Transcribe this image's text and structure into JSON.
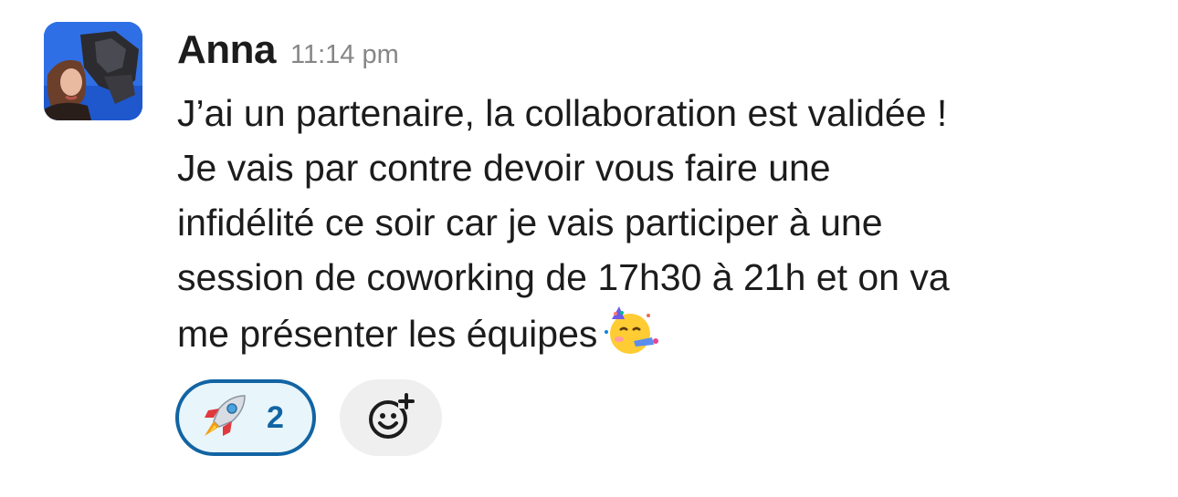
{
  "message": {
    "sender": "Anna",
    "timestamp": "11:14 pm",
    "lines": [
      "J’ai un partenaire, la collaboration est validée !",
      "Je vais par contre devoir vous faire une",
      "infidélité ce soir car je vais participer à une",
      "session de coworking de 17h30 à 21h et on va",
      "me présenter les équipes"
    ],
    "inline_emoji": "partying-face-icon"
  },
  "reactions": [
    {
      "emoji": "rocket-icon",
      "count": "2",
      "selected": true
    }
  ],
  "add_reaction": {
    "icon": "add-reaction-icon"
  },
  "colors": {
    "text": "#1d1c1d",
    "timestamp": "#868686",
    "reaction_border": "#1264a3",
    "reaction_bg": "#e8f5fa",
    "add_reaction_bg": "#efefef",
    "avatar_bg": "#2f6fe6"
  }
}
